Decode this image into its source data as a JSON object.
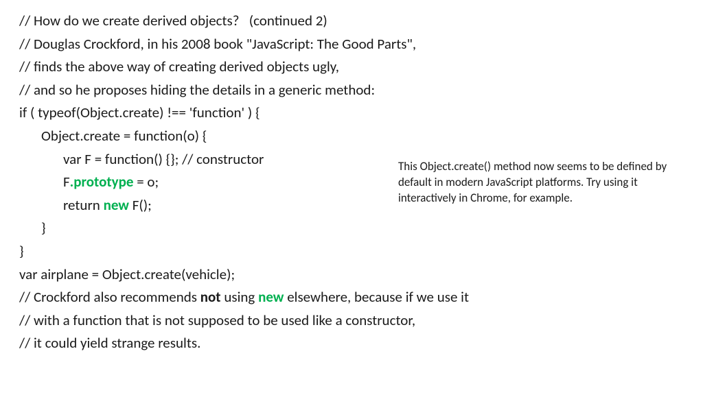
{
  "lines": {
    "l1": "// How do we create derived objects?   (continued 2)",
    "l2": "// Douglas Crockford, in his 2008 book \"JavaScript: The Good Parts\",",
    "l3": "// finds the above way of creating derived objects ugly,",
    "l4": "// and so he proposes hiding the details in a generic method:",
    "l5": "if ( typeof(Object.create) !== 'function' ) {",
    "l6": "Object.create = function(o) {",
    "l7": "var F = function() {}; // constructor",
    "l8a": "F",
    "l8b": ".prototype",
    "l8c": " = o;",
    "l9a": "return ",
    "l9b": "new",
    "l9c": " F();",
    "l10": "}",
    "l11": "}",
    "l12": "var airplane = Object.create(vehicle);",
    "l13a": "// Crockford also recommends ",
    "l13b": "not",
    "l13c": " using ",
    "l13d": "new",
    "l13e": " elsewhere, because if we use it",
    "l14": "// with a function that is not supposed to be used like a constructor,",
    "l15": "// it could yield strange results."
  },
  "sidenote": "This Object.create() method now seems to be defined by default in modern JavaScript platforms.  Try using it interactively in Chrome, for example."
}
